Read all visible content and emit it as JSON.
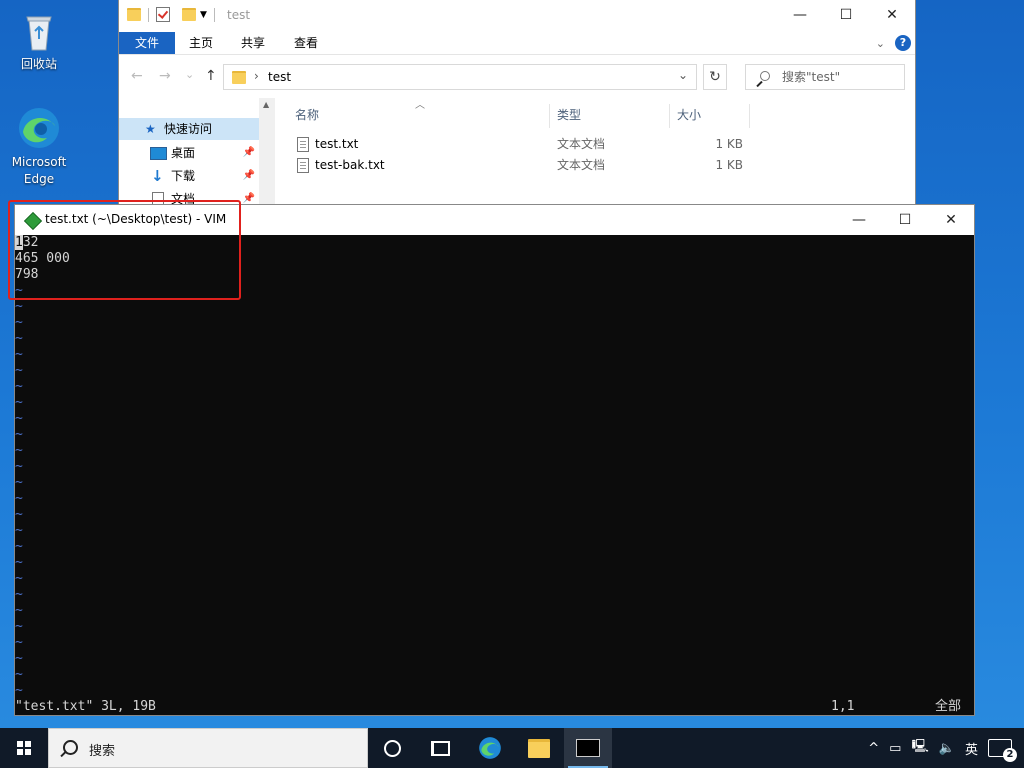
{
  "desktop": {
    "recycle_bin": "回收站",
    "edge_line1": "Microsoft",
    "edge_line2": "Edge"
  },
  "explorer": {
    "title": "test",
    "controls": {
      "minimize": "—",
      "maximize": "☐",
      "close": "✕"
    },
    "ribbon": {
      "file": "文件",
      "home": "主页",
      "share": "共享",
      "view": "查看",
      "help": "?"
    },
    "nav": {
      "back": "←",
      "forward": "→",
      "recent": "⌄",
      "up": "↑"
    },
    "address": {
      "chevron": "›",
      "path": "test",
      "dropdown": "⌄"
    },
    "refresh": "↻",
    "search_placeholder": "搜索\"test\"",
    "navpane": [
      {
        "label": "快速访问",
        "selected": true
      },
      {
        "label": "桌面",
        "pinned": true
      },
      {
        "label": "下载",
        "pinned": true
      },
      {
        "label": "文档",
        "pinned": true
      }
    ],
    "columns": {
      "name": "名称",
      "type": "类型",
      "size": "大小"
    },
    "files": [
      {
        "name": "test.txt",
        "type": "文本文档",
        "size": "1 KB"
      },
      {
        "name": "test-bak.txt",
        "type": "文本文档",
        "size": "1 KB"
      }
    ]
  },
  "vim": {
    "title": "test.txt (~\\Desktop\\test) - VIM",
    "controls": {
      "minimize": "—",
      "maximize": "☐",
      "close": "✕"
    },
    "lines": {
      "line1_cursor": "1",
      "line1_rest": "32",
      "line2": "465 000",
      "line3": "798"
    },
    "tilde": "~",
    "status": {
      "file_info": "\"test.txt\" 3L, 19B",
      "position": "1,1",
      "scroll": "全部"
    }
  },
  "taskbar": {
    "search_label": "搜索",
    "tray": {
      "chevron": "^",
      "ime": "英",
      "notifications": "2"
    }
  },
  "colors": {
    "accent": "#1a64c2",
    "highlight": "#e0211d",
    "vim_bg": "#0c0c0c",
    "vim_tilde": "#4b72cc",
    "taskbar": "#101a28"
  }
}
